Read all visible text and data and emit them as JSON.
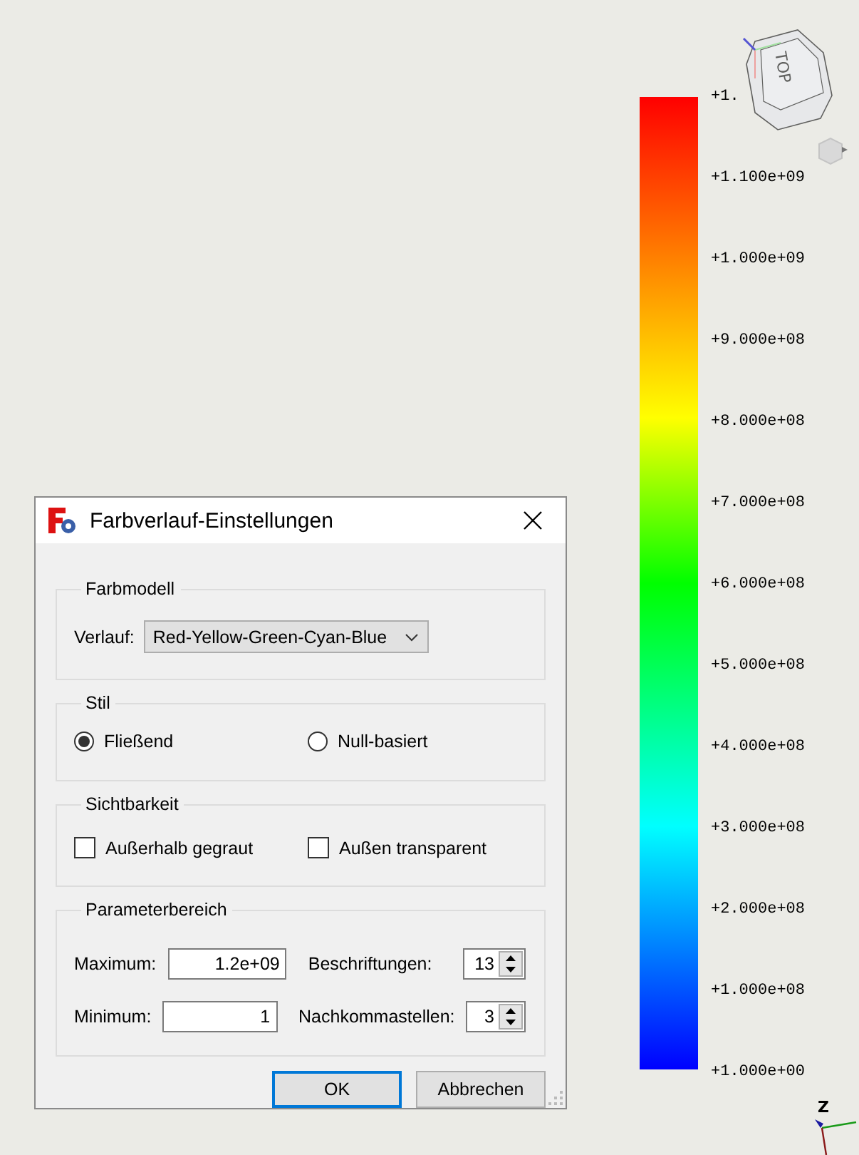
{
  "nav_cube": {
    "face": "TOP"
  },
  "color_bar": {
    "labels": [
      "+1.",
      "+1.100e+09",
      "+1.000e+09",
      "+9.000e+08",
      "+8.000e+08",
      "+7.000e+08",
      "+6.000e+08",
      "+5.000e+08",
      "+4.000e+08",
      "+3.000e+08",
      "+2.000e+08",
      "+1.000e+08",
      "+1.000e+00"
    ]
  },
  "axis": {
    "label": "Z"
  },
  "dialog": {
    "title": "Farbverlauf-Einstellungen",
    "color_model": {
      "title": "Farbmodell",
      "label": "Verlauf:",
      "value": "Red-Yellow-Green-Cyan-Blue"
    },
    "style": {
      "title": "Stil",
      "options": [
        {
          "label": "Fließend",
          "selected": true
        },
        {
          "label": "Null-basiert",
          "selected": false
        }
      ]
    },
    "visibility": {
      "title": "Sichtbarkeit",
      "options": [
        {
          "label": "Außerhalb gegraut",
          "checked": false
        },
        {
          "label": "Außen transparent",
          "checked": false
        }
      ]
    },
    "range": {
      "title": "Parameterbereich",
      "rows": [
        {
          "field": {
            "label": "Maximum:",
            "value": "1.2e+09"
          },
          "spinner": {
            "label": "Beschriftungen:",
            "value": "13"
          }
        },
        {
          "field": {
            "label": "Minimum:",
            "value": "1"
          },
          "spinner": {
            "label": "Nachkommastellen:",
            "value": "3"
          }
        }
      ]
    },
    "buttons": [
      {
        "label": "OK",
        "default": true
      },
      {
        "label": "Abbrechen",
        "default": false
      }
    ]
  }
}
